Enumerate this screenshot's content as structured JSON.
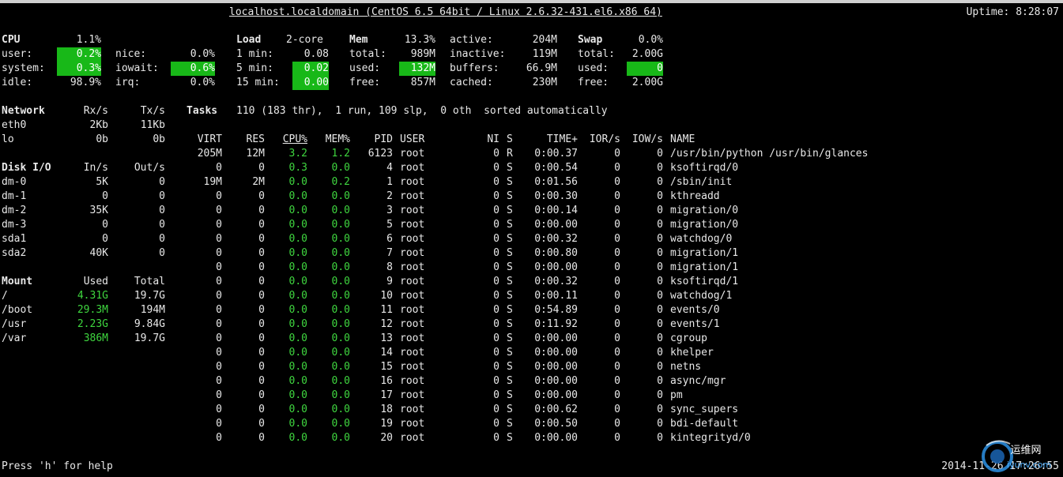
{
  "header": {
    "host": "localhost.localdomain (CentOS 6.5 64bit / Linux 2.6.32-431.el6.x86 64)",
    "uptime": "Uptime: 8:28:07"
  },
  "cpu": {
    "title": "CPU",
    "total": "1.1%",
    "user_label": "user:",
    "user": "0.2%",
    "system_label": "system:",
    "system": "0.3%",
    "idle_label": "idle:",
    "idle": "98.9%",
    "nice_label": "nice:",
    "nice": "0.0%",
    "iowait_label": "iowait:",
    "iowait": "0.6%",
    "irq_label": "irq:",
    "irq": "0.0%"
  },
  "load": {
    "title": "Load",
    "cores": "2-core",
    "m1_label": "1 min:",
    "m1": "0.08",
    "m5_label": "5 min:",
    "m5": "0.02",
    "m15_label": "15 min:",
    "m15": "0.00"
  },
  "mem": {
    "title": "Mem",
    "percent": "13.3%",
    "total_label": "total:",
    "total": "989M",
    "used_label": "used:",
    "used": "132M",
    "free_label": "free:",
    "free": "857M",
    "active_label": "active:",
    "active": "204M",
    "inactive_label": "inactive:",
    "inactive": "119M",
    "buffers_label": "buffers:",
    "buffers": "66.9M",
    "cached_label": "cached:",
    "cached": "230M"
  },
  "swap": {
    "title": "Swap",
    "percent": "0.0%",
    "total_label": "total:",
    "total": "2.00G",
    "used_label": "used:",
    "used": "0",
    "free_label": "free:",
    "free": "2.00G"
  },
  "network": {
    "title": "Network",
    "rx_header": "Rx/s",
    "tx_header": "Tx/s",
    "rows": [
      {
        "name": "eth0",
        "rx": "2Kb",
        "tx": "11Kb"
      },
      {
        "name": "lo",
        "rx": "0b",
        "tx": "0b"
      }
    ]
  },
  "diskio": {
    "title": "Disk I/O",
    "in_header": "In/s",
    "out_header": "Out/s",
    "rows": [
      {
        "name": "dm-0",
        "in": "5K",
        "out": "0"
      },
      {
        "name": "dm-1",
        "in": "0",
        "out": "0"
      },
      {
        "name": "dm-2",
        "in": "35K",
        "out": "0"
      },
      {
        "name": "dm-3",
        "in": "0",
        "out": "0"
      },
      {
        "name": "sda1",
        "in": "0",
        "out": "0"
      },
      {
        "name": "sda2",
        "in": "40K",
        "out": "0"
      }
    ]
  },
  "mount": {
    "title": "Mount",
    "used_header": "Used",
    "total_header": "Total",
    "rows": [
      {
        "name": "/",
        "used": "4.31G",
        "total": "19.7G"
      },
      {
        "name": "/boot",
        "used": "29.3M",
        "total": "194M"
      },
      {
        "name": "/usr",
        "used": "2.23G",
        "total": "9.84G"
      },
      {
        "name": "/var",
        "used": "386M",
        "total": "19.7G"
      }
    ]
  },
  "tasks": {
    "title": "Tasks",
    "summary": "110 (183 thr),  1 run, 109 slp,  0 oth  sorted automatically"
  },
  "processes": {
    "headers": {
      "virt": "VIRT",
      "res": "RES",
      "cpu": "CPU%",
      "mem": "MEM%",
      "pid": "PID",
      "user": "USER",
      "ni": "NI",
      "s": "S",
      "time": "TIME+",
      "ior": "IOR/s",
      "iow": "IOW/s",
      "name": "NAME"
    },
    "rows": [
      {
        "virt": "205M",
        "res": "12M",
        "cpu": "3.2",
        "mem": "1.2",
        "pid": "6123",
        "user": "root",
        "ni": "0",
        "s": "R",
        "time": "0:00.37",
        "ior": "0",
        "iow": "0",
        "name": "/usr/bin/python /usr/bin/glances"
      },
      {
        "virt": "0",
        "res": "0",
        "cpu": "0.3",
        "mem": "0.0",
        "pid": "4",
        "user": "root",
        "ni": "0",
        "s": "S",
        "time": "0:00.54",
        "ior": "0",
        "iow": "0",
        "name": "ksoftirqd/0"
      },
      {
        "virt": "19M",
        "res": "2M",
        "cpu": "0.0",
        "mem": "0.2",
        "pid": "1",
        "user": "root",
        "ni": "0",
        "s": "S",
        "time": "0:01.56",
        "ior": "0",
        "iow": "0",
        "name": "/sbin/init"
      },
      {
        "virt": "0",
        "res": "0",
        "cpu": "0.0",
        "mem": "0.0",
        "pid": "2",
        "user": "root",
        "ni": "0",
        "s": "S",
        "time": "0:00.30",
        "ior": "0",
        "iow": "0",
        "name": "kthreadd"
      },
      {
        "virt": "0",
        "res": "0",
        "cpu": "0.0",
        "mem": "0.0",
        "pid": "3",
        "user": "root",
        "ni": "0",
        "s": "S",
        "time": "0:00.14",
        "ior": "0",
        "iow": "0",
        "name": "migration/0"
      },
      {
        "virt": "0",
        "res": "0",
        "cpu": "0.0",
        "mem": "0.0",
        "pid": "5",
        "user": "root",
        "ni": "0",
        "s": "S",
        "time": "0:00.00",
        "ior": "0",
        "iow": "0",
        "name": "migration/0"
      },
      {
        "virt": "0",
        "res": "0",
        "cpu": "0.0",
        "mem": "0.0",
        "pid": "6",
        "user": "root",
        "ni": "0",
        "s": "S",
        "time": "0:00.32",
        "ior": "0",
        "iow": "0",
        "name": "watchdog/0"
      },
      {
        "virt": "0",
        "res": "0",
        "cpu": "0.0",
        "mem": "0.0",
        "pid": "7",
        "user": "root",
        "ni": "0",
        "s": "S",
        "time": "0:00.80",
        "ior": "0",
        "iow": "0",
        "name": "migration/1"
      },
      {
        "virt": "0",
        "res": "0",
        "cpu": "0.0",
        "mem": "0.0",
        "pid": "8",
        "user": "root",
        "ni": "0",
        "s": "S",
        "time": "0:00.00",
        "ior": "0",
        "iow": "0",
        "name": "migration/1"
      },
      {
        "virt": "0",
        "res": "0",
        "cpu": "0.0",
        "mem": "0.0",
        "pid": "9",
        "user": "root",
        "ni": "0",
        "s": "S",
        "time": "0:00.32",
        "ior": "0",
        "iow": "0",
        "name": "ksoftirqd/1"
      },
      {
        "virt": "0",
        "res": "0",
        "cpu": "0.0",
        "mem": "0.0",
        "pid": "10",
        "user": "root",
        "ni": "0",
        "s": "S",
        "time": "0:00.11",
        "ior": "0",
        "iow": "0",
        "name": "watchdog/1"
      },
      {
        "virt": "0",
        "res": "0",
        "cpu": "0.0",
        "mem": "0.0",
        "pid": "11",
        "user": "root",
        "ni": "0",
        "s": "S",
        "time": "0:54.89",
        "ior": "0",
        "iow": "0",
        "name": "events/0"
      },
      {
        "virt": "0",
        "res": "0",
        "cpu": "0.0",
        "mem": "0.0",
        "pid": "12",
        "user": "root",
        "ni": "0",
        "s": "S",
        "time": "0:11.92",
        "ior": "0",
        "iow": "0",
        "name": "events/1"
      },
      {
        "virt": "0",
        "res": "0",
        "cpu": "0.0",
        "mem": "0.0",
        "pid": "13",
        "user": "root",
        "ni": "0",
        "s": "S",
        "time": "0:00.00",
        "ior": "0",
        "iow": "0",
        "name": "cgroup"
      },
      {
        "virt": "0",
        "res": "0",
        "cpu": "0.0",
        "mem": "0.0",
        "pid": "14",
        "user": "root",
        "ni": "0",
        "s": "S",
        "time": "0:00.00",
        "ior": "0",
        "iow": "0",
        "name": "khelper"
      },
      {
        "virt": "0",
        "res": "0",
        "cpu": "0.0",
        "mem": "0.0",
        "pid": "15",
        "user": "root",
        "ni": "0",
        "s": "S",
        "time": "0:00.00",
        "ior": "0",
        "iow": "0",
        "name": "netns"
      },
      {
        "virt": "0",
        "res": "0",
        "cpu": "0.0",
        "mem": "0.0",
        "pid": "16",
        "user": "root",
        "ni": "0",
        "s": "S",
        "time": "0:00.00",
        "ior": "0",
        "iow": "0",
        "name": "async/mgr"
      },
      {
        "virt": "0",
        "res": "0",
        "cpu": "0.0",
        "mem": "0.0",
        "pid": "17",
        "user": "root",
        "ni": "0",
        "s": "S",
        "time": "0:00.00",
        "ior": "0",
        "iow": "0",
        "name": "pm"
      },
      {
        "virt": "0",
        "res": "0",
        "cpu": "0.0",
        "mem": "0.0",
        "pid": "18",
        "user": "root",
        "ni": "0",
        "s": "S",
        "time": "0:00.62",
        "ior": "0",
        "iow": "0",
        "name": "sync_supers"
      },
      {
        "virt": "0",
        "res": "0",
        "cpu": "0.0",
        "mem": "0.0",
        "pid": "19",
        "user": "root",
        "ni": "0",
        "s": "S",
        "time": "0:00.50",
        "ior": "0",
        "iow": "0",
        "name": "bdi-default"
      },
      {
        "virt": "0",
        "res": "0",
        "cpu": "0.0",
        "mem": "0.0",
        "pid": "20",
        "user": "root",
        "ni": "0",
        "s": "S",
        "time": "0:00.00",
        "ior": "0",
        "iow": "0",
        "name": "kintegrityd/0"
      }
    ]
  },
  "footer": {
    "help": "Press 'h' for help",
    "datetime": "2014-11-26 17:26:55"
  },
  "watermark": {
    "text_top": "运维网",
    "text_bottom": "iyunv.com"
  },
  "colors": {
    "background": "#000000",
    "text": "#e8e8e8",
    "ok_green": "#3fd63f",
    "highlight_green": "#18b818"
  }
}
